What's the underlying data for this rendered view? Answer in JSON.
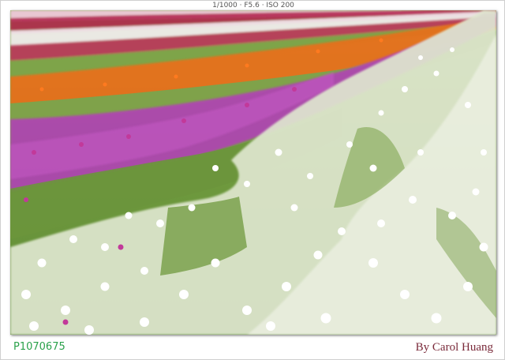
{
  "header": {
    "exif": "1/1000 · F5.6 · ISO 200"
  },
  "footer": {
    "file_id": "P1070675",
    "credit": "By Carol Huang"
  },
  "photo": {
    "subject": "cosmos-flower-field",
    "colors": {
      "grass": "#7da34a",
      "grass_dark": "#4e7a2c",
      "white_flowers": "#ffffff",
      "magenta_flowers": "#b23fb8",
      "orange_flowers": "#f26a12",
      "crimson_flowers": "#b0204a",
      "file_id_green": "#2aa14a",
      "credit_maroon": "#7a2a3a"
    }
  }
}
